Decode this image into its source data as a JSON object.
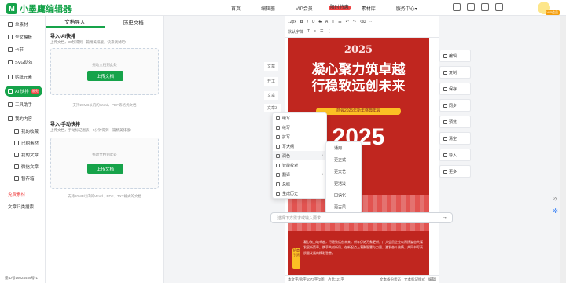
{
  "brand": {
    "name": "小墨鹰编辑器",
    "accent": "#16a34a"
  },
  "topnav": [
    {
      "label": "首页"
    },
    {
      "label": "编辑器"
    },
    {
      "label": "VIP会员",
      "badge": "限时特惠"
    },
    {
      "label": "素材库"
    },
    {
      "label": "服务中心",
      "caret": "▾"
    }
  ],
  "user": {
    "vip_tag": "VIP会员"
  },
  "sidebar": {
    "items": [
      {
        "label": "单素材",
        "icon": "doc-icon"
      },
      {
        "label": "全文模板",
        "icon": "template-icon"
      },
      {
        "label": "卡节",
        "icon": "card-icon"
      },
      {
        "label": "SVG动效",
        "icon": "svg-icon"
      },
      {
        "label": "贴纸元素",
        "icon": "sticker-icon"
      },
      {
        "label": "AI 快排",
        "icon": "ai-icon",
        "hot": "限免"
      },
      {
        "label": "工具助手",
        "icon": "tool-icon"
      },
      {
        "label": "我的内容",
        "icon": "folder-icon"
      },
      {
        "label": "我的收藏",
        "icon": "star-icon",
        "sub": true
      },
      {
        "label": "已购素材",
        "icon": "bag-icon",
        "sub": true
      },
      {
        "label": "我的文章",
        "icon": "article-icon",
        "sub": true
      },
      {
        "label": "微信文章",
        "icon": "wechat-icon",
        "sub": true
      },
      {
        "label": "暂存箱",
        "icon": "box-icon",
        "sub": true
      },
      {
        "label": "免费素材",
        "icon": "",
        "special": true
      },
      {
        "label": "文章归类搜索",
        "icon": ""
      }
    ],
    "footer_id": "墨ID号16024459号-1"
  },
  "panel": {
    "tabs": [
      "文档导入",
      "历史文档"
    ],
    "sections": [
      {
        "title": "导入-AI快排",
        "subtitle": "上传文档，30秒得到一篇精美排版，快来试试吧!",
        "hint": "拖动文档到此处",
        "button": "上传文档",
        "support": "支持20MB以内的Word、PDF等格式文档"
      },
      {
        "title": "导入-手动快排",
        "subtitle": "上传文档，手动标记图表，5分钟得到一篇精美排版!",
        "hint": "拖动文档到此处",
        "button": "上传文档",
        "support": "支持20MB以内的Word、PDF、TXT格式的文档"
      }
    ]
  },
  "mini_docs": [
    "文章",
    "开工",
    "文章",
    "文章3"
  ],
  "editor": {
    "toolbar_row1": [
      "12px",
      "B",
      "I",
      "U",
      "S",
      "A",
      "≡",
      "☷",
      "↶",
      "↷",
      "⌫",
      "⋯"
    ],
    "toolbar_row2": [
      "默认字体",
      "T",
      "≡",
      "☰",
      "⋮"
    ],
    "doc": {
      "year_top": "2025",
      "headline1": "凝心聚力筑卓越",
      "headline2": "行稳致远创未来",
      "band": "商会2025年新年盛典年会",
      "year_big": "2025",
      "body": "凝心聚力筑卓越，行稳致远创未来。新年伊始万象更新，广大会员企业以昂扬姿态共谋发展新篇章。携手共创新局，在新起点上凝聚智慧与力量，激发奋斗热情，共同书写高质量发展的精彩答卷。",
      "seal": "招商引资"
    },
    "status_left": "本文字/总字1073字/2图，占比121字",
    "status_right": [
      "文本备份状态",
      "文本标记样式",
      "编辑"
    ]
  },
  "context_menu": {
    "items": [
      {
        "label": "续写",
        "icon": "continue-icon"
      },
      {
        "label": "续写",
        "icon": "continue-icon"
      },
      {
        "label": "扩写",
        "icon": "expand-icon"
      },
      {
        "label": "写大纲",
        "icon": "outline-icon"
      },
      {
        "label": "润色",
        "icon": "polish-icon",
        "arrow": "›",
        "highlight": true
      },
      {
        "label": "智能校对",
        "icon": "check-icon"
      },
      {
        "label": "翻译",
        "icon": "translate-icon",
        "arrow": "›"
      },
      {
        "label": "总结",
        "icon": "summary-icon"
      },
      {
        "label": "生成历史",
        "icon": "history-icon"
      }
    ],
    "submenu": [
      "通用",
      "更正式",
      "更文艺",
      "更活泼",
      "口语化",
      "更古风"
    ]
  },
  "ai_input": {
    "placeholder": "选择下方需求或输入要求",
    "send": "→"
  },
  "right_tools": [
    "编辑",
    "复制",
    "保存",
    "同步",
    "预览",
    "清空",
    "导入",
    "更多"
  ],
  "floats": {
    "a": "☼",
    "b": "✲"
  }
}
